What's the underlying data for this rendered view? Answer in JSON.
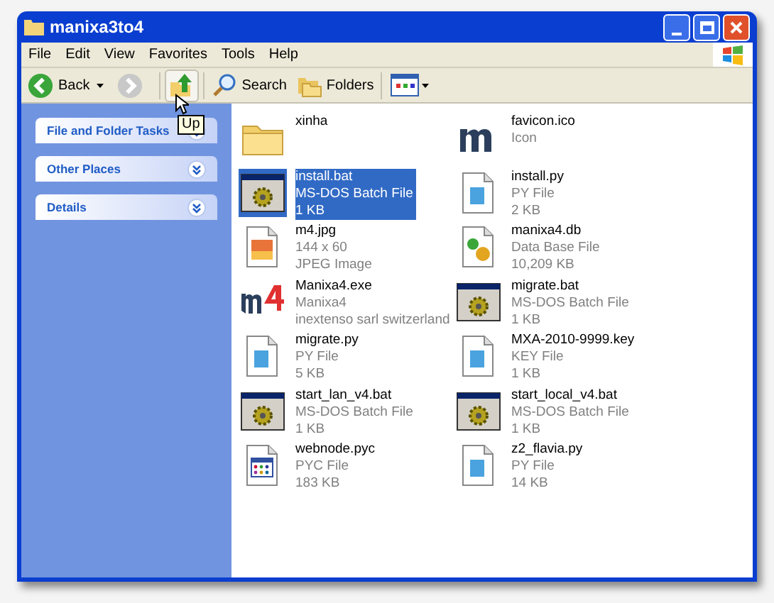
{
  "window": {
    "title": "manixa3to4"
  },
  "menu": [
    "File",
    "Edit",
    "View",
    "Favorites",
    "Tools",
    "Help"
  ],
  "toolbar": {
    "back": "Back",
    "search": "Search",
    "folders": "Folders",
    "tooltip": "Up"
  },
  "sidebar": {
    "panels": [
      {
        "title": "File and Folder Tasks",
        "expanded": false
      },
      {
        "title": "Other Places",
        "expanded": false
      },
      {
        "title": "Details",
        "expanded": false
      }
    ]
  },
  "files": [
    {
      "kind": "folder",
      "name": "xinha",
      "selected": false
    },
    {
      "kind": "mlogo",
      "name": "favicon.ico",
      "details": [
        "Icon"
      ],
      "selected": false
    },
    {
      "kind": "batch",
      "name": "install.bat",
      "details": [
        "MS-DOS Batch File",
        "1 KB"
      ],
      "selected": true
    },
    {
      "kind": "script",
      "name": "install.py",
      "details": [
        "PY File",
        "2 KB"
      ],
      "selected": false
    },
    {
      "kind": "image",
      "name": "m4.jpg",
      "details": [
        "144 x 60",
        "JPEG Image"
      ],
      "selected": false
    },
    {
      "kind": "database",
      "name": "manixa4.db",
      "details": [
        "Data Base File",
        "10,209 KB"
      ],
      "selected": false
    },
    {
      "kind": "app",
      "name": "Manixa4.exe",
      "details": [
        "Manixa4",
        "inextenso sarl switzerland"
      ],
      "selected": false
    },
    {
      "kind": "batch",
      "name": "migrate.bat",
      "details": [
        "MS-DOS Batch File",
        "1 KB"
      ],
      "selected": false
    },
    {
      "kind": "script",
      "name": "migrate.py",
      "details": [
        "PY File",
        "5 KB"
      ],
      "selected": false
    },
    {
      "kind": "script",
      "name": "MXA-2010-9999.key",
      "details": [
        "KEY File",
        "1 KB"
      ],
      "selected": false
    },
    {
      "kind": "batch",
      "name": "start_lan_v4.bat",
      "details": [
        "MS-DOS Batch File",
        "1 KB"
      ],
      "selected": false
    },
    {
      "kind": "batch",
      "name": "start_local_v4.bat",
      "details": [
        "MS-DOS Batch File",
        "1 KB"
      ],
      "selected": false
    },
    {
      "kind": "compiled",
      "name": "webnode.pyc",
      "details": [
        "PYC File",
        "183 KB"
      ],
      "selected": false
    },
    {
      "kind": "script",
      "name": "z2_flavia.py",
      "details": [
        "PY File",
        "14 KB"
      ],
      "selected": false
    }
  ]
}
